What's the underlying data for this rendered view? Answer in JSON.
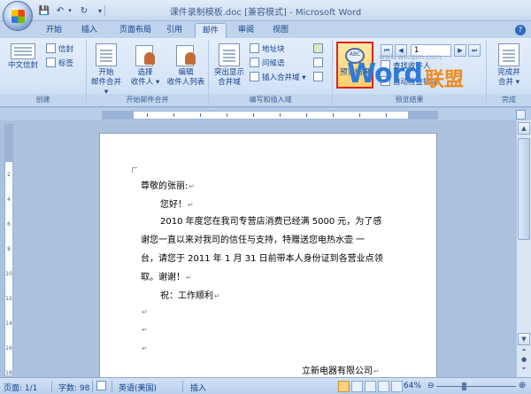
{
  "window": {
    "title": "课件录制模板.doc [兼容模式] - Microsoft Word"
  },
  "qat": {
    "save": "💾",
    "undo": "↶",
    "undo_dropdown": "▾",
    "redo": "↻",
    "customize": "▾"
  },
  "tabs": [
    "开始",
    "插入",
    "页面布局",
    "引用",
    "邮件",
    "审阅",
    "视图"
  ],
  "active_tab": "邮件",
  "ribbon": {
    "groups": {
      "create": {
        "label": "创建",
        "chinese_envelope": "中文信封",
        "envelopes": "信封",
        "labels": "标签"
      },
      "start_merge": {
        "label": "开始邮件合并",
        "start_merge_btn_1": "开始",
        "start_merge_btn_2": "邮件合并 ▾",
        "select_recipients_1": "选择",
        "select_recipients_2": "收件人 ▾",
        "edit_list_1": "编辑",
        "edit_list_2": "收件人列表"
      },
      "write_insert": {
        "label": "编写和插入域",
        "highlight_fields_1": "突出显示",
        "highlight_fields_2": "合并域",
        "address_block": "地址块",
        "greeting_line": "问候语",
        "insert_merge_field": "插入合并域 ▾"
      },
      "preview": {
        "label": "预览结果",
        "preview_results": "预览结果",
        "record_number": "1",
        "find_recipient": "查找收件人",
        "auto_check_errors": "自动检查错误"
      },
      "finish": {
        "label": "完成",
        "finish_merge_1": "完成并",
        "finish_merge_2": "合并 ▾"
      }
    }
  },
  "nav_buttons": {
    "first": "⏮",
    "prev": "◀",
    "next": "▶",
    "last": "⏭"
  },
  "ruler": {
    "vertical_numbers": "2\n\n4\n\n6\n\n8\n\n10\n\n12\n\n14\n\n16\n\n18"
  },
  "document": {
    "lines": [
      "尊敬的张丽:",
      "您好！",
      "2010 年度您在我司专营店消费已经满 5000 元，为了感",
      "谢您一直以来对我司的信任与支持，特赠送您电热水壶 一",
      "台，请您于 2011 年 1 月 31 日前带本人身份证到各营业点领",
      "取。谢谢！",
      "祝：工作顺利",
      "",
      "",
      "",
      "立新电器有限公司"
    ],
    "paragraph_mark": "↵"
  },
  "watermark": {
    "url": "www.wordlm.com",
    "logo_word": "Word",
    "logo_cn": "联盟"
  },
  "status": {
    "page": "页面: 1/1",
    "words": "字数: 98",
    "language": "英语(美国)",
    "mode": "插入",
    "zoom": "64%",
    "zoom_level": 0.64
  },
  "colors": {
    "ribbon_bg": "#dde9f7",
    "highlight_border": "#e2221b",
    "text": "#15428b"
  }
}
